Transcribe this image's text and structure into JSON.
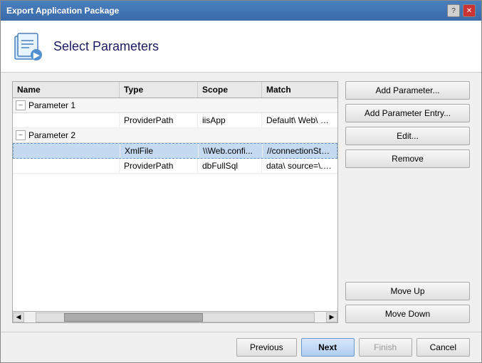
{
  "window": {
    "title": "Export Application Package"
  },
  "header": {
    "title": "Select Parameters"
  },
  "table": {
    "columns": [
      "Name",
      "Type",
      "Scope",
      "Match"
    ],
    "groups": [
      {
        "name": "Parameter 1",
        "expanded": true,
        "entries": [
          {
            "name": "",
            "type": "ProviderPath",
            "scope": "iisApp",
            "match": "Default\\ Web\\ Site/M"
          }
        ]
      },
      {
        "name": "Parameter 2",
        "expanded": true,
        "entries": [
          {
            "name": "",
            "type": "XmlFile",
            "scope": "\\\\Web.confi...",
            "match": "//connectionStrings",
            "selected": true
          },
          {
            "name": "",
            "type": "ProviderPath",
            "scope": "dbFullSql",
            "match": "data\\ source=\\.\\\\SQ"
          }
        ]
      }
    ]
  },
  "buttons": {
    "add_parameter": "Add Parameter...",
    "add_parameter_entry": "Add Parameter Entry...",
    "edit": "Edit...",
    "remove": "Remove",
    "move_up": "Move Up",
    "move_down": "Move Down"
  },
  "footer": {
    "previous": "Previous",
    "next": "Next",
    "finish": "Finish",
    "cancel": "Cancel"
  }
}
